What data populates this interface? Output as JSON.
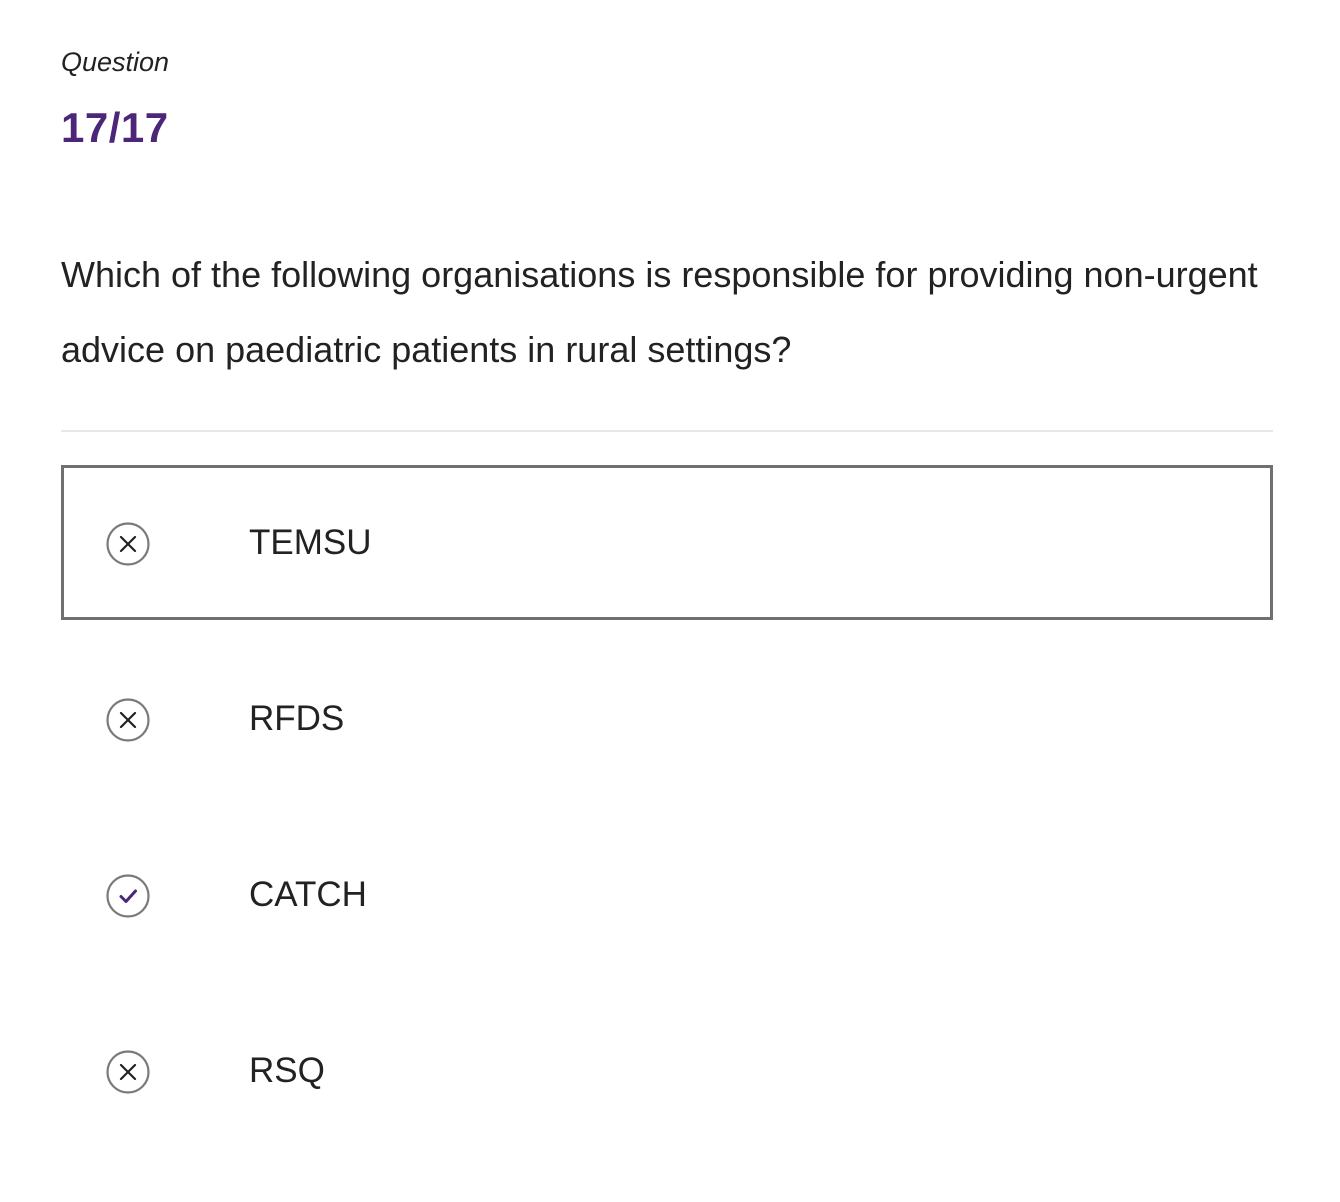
{
  "header": {
    "label": "Question",
    "counter": "17/17"
  },
  "question": {
    "text": "Which of the following organisations is responsible for providing non-urgent advice on paediatric patients in rural settings?"
  },
  "options": [
    {
      "label": "TEMSU",
      "status": "incorrect",
      "icon": "close-icon",
      "selected": true
    },
    {
      "label": "RFDS",
      "status": "incorrect",
      "icon": "close-icon",
      "selected": false
    },
    {
      "label": "CATCH",
      "status": "correct",
      "icon": "check-icon",
      "selected": false
    },
    {
      "label": "RSQ",
      "status": "incorrect",
      "icon": "close-icon",
      "selected": false
    }
  ],
  "colors": {
    "accent": "#4b2679",
    "icon_ring": "#7a7a7a",
    "selected_border": "#707070",
    "text": "#222222"
  }
}
